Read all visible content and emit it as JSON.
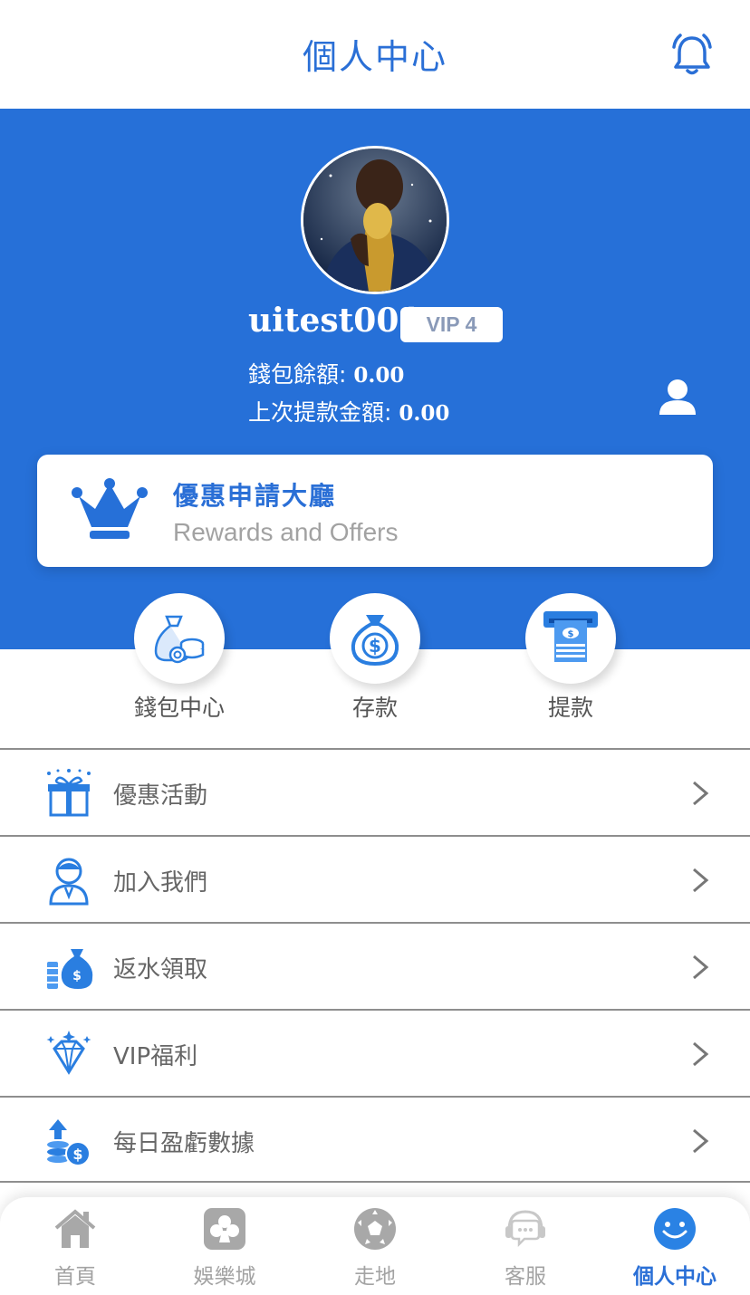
{
  "header": {
    "title": "個人中心",
    "bell_icon": "bell-icon"
  },
  "profile": {
    "username": "uitest001",
    "vip": "VIP 4",
    "wallet_label": "錢包餘額: ",
    "wallet_value": "0.00",
    "last_withdraw_label": "上次提款金額: ",
    "last_withdraw_value": "0.00"
  },
  "rewards": {
    "title": "優惠申請大廳",
    "subtitle": "Rewards and Offers"
  },
  "actions": [
    {
      "label": "錢包中心",
      "icon": "money-bag-coins-icon"
    },
    {
      "label": "存款",
      "icon": "dollar-bag-icon"
    },
    {
      "label": "提款",
      "icon": "atm-cash-icon"
    }
  ],
  "menu": [
    {
      "label": "優惠活動",
      "icon": "gift-icon"
    },
    {
      "label": "加入我們",
      "icon": "agent-icon"
    },
    {
      "label": "返水領取",
      "icon": "rebate-bag-icon"
    },
    {
      "label": "VIP福利",
      "icon": "diamond-icon"
    },
    {
      "label": "每日盈虧數據",
      "icon": "coins-upload-icon"
    }
  ],
  "nav": [
    {
      "label": "首頁",
      "icon": "home-icon"
    },
    {
      "label": "娛樂城",
      "icon": "casino-icon"
    },
    {
      "label": "走地",
      "icon": "soccer-ball-icon"
    },
    {
      "label": "客服",
      "icon": "support-chat-icon"
    },
    {
      "label": "個人中心",
      "icon": "smile-icon",
      "active": true
    }
  ],
  "colors": {
    "primary": "#2670d8",
    "accent_text": "#2a6fd6",
    "muted": "#a3a3a3"
  }
}
